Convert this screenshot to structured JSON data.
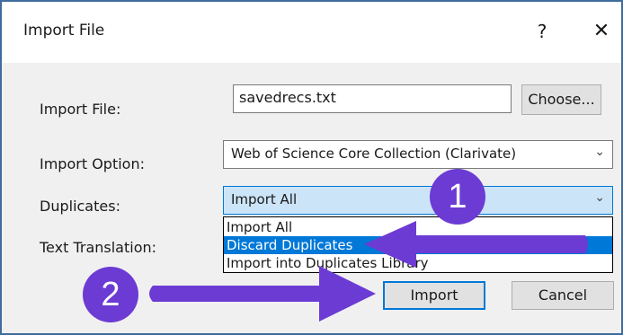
{
  "window": {
    "title": "Import File",
    "help_glyph": "?",
    "close_glyph": "✕"
  },
  "form": {
    "import_file_label": "Import File:",
    "import_file_value": "savedrecs.txt",
    "choose_label": "Choose...",
    "import_option_label": "Import Option:",
    "import_option_value": "Web of Science Core Collection (Clarivate)",
    "duplicates_label": "Duplicates:",
    "duplicates_value": "Import All",
    "text_translation_label": "Text Translation:"
  },
  "duplicates_dropdown": {
    "options": [
      "Import All",
      "Discard Duplicates",
      "Import into Duplicates Library"
    ],
    "highlighted_index": 1
  },
  "buttons": {
    "import_label": "Import",
    "cancel_label": "Cancel"
  },
  "annotations": {
    "step1": "1",
    "step2": "2",
    "color": "#6c3bd4"
  }
}
